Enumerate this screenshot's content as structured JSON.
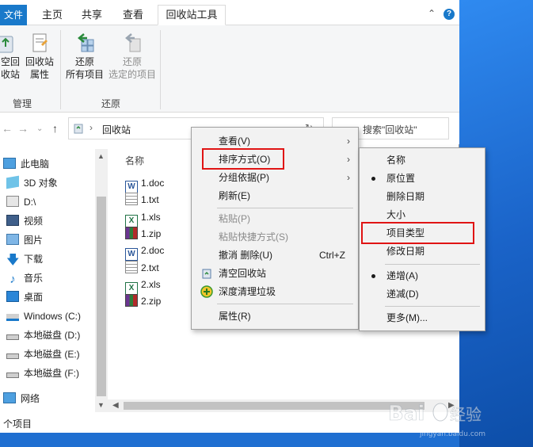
{
  "tabs": {
    "file": "文件",
    "home": "主页",
    "share": "共享",
    "view": "查看",
    "tools": "回收站工具"
  },
  "ribbon": {
    "empty_bin": [
      "空回",
      "收站"
    ],
    "bin_props": [
      "回收站",
      "属性"
    ],
    "restore_all": [
      "还原",
      "所有项目"
    ],
    "restore_selected": [
      "还原",
      "选定的项目"
    ],
    "group_manage": "管理",
    "group_restore": "还原"
  },
  "address": {
    "path": "回收站",
    "search_placeholder": "搜索\"回收站\""
  },
  "navpane": {
    "items": [
      "此电脑",
      "3D 对象",
      "D:\\",
      "视频",
      "图片",
      "下载",
      "音乐",
      "桌面",
      "Windows (C:)",
      "本地磁盘 (D:)",
      "本地磁盘 (E:)",
      "本地磁盘 (F:)",
      "网络"
    ]
  },
  "content": {
    "column_name": "名称",
    "files": [
      {
        "name": "1.doc",
        "type": "doc"
      },
      {
        "name": "1.txt",
        "type": "txt"
      },
      {
        "name": "1.xls",
        "type": "xls"
      },
      {
        "name": "1.zip",
        "type": "zip"
      },
      {
        "name": "2.doc",
        "type": "doc"
      },
      {
        "name": "2.txt",
        "type": "txt"
      },
      {
        "name": "2.xls",
        "type": "xls"
      },
      {
        "name": "2.zip",
        "type": "zip"
      }
    ]
  },
  "status": {
    "items": "个项目"
  },
  "context_menu": {
    "view": "查看(V)",
    "sort": "排序方式(O)",
    "group": "分组依据(P)",
    "refresh": "刷新(E)",
    "paste": "粘贴(P)",
    "paste_shortcut": "粘贴快捷方式(S)",
    "undo": "撤消 删除(U)",
    "undo_shortcut": "Ctrl+Z",
    "empty_bin": "清空回收站",
    "deep_clean": "深度清理垃圾",
    "properties": "属性(R)"
  },
  "sort_menu": {
    "name": "名称",
    "original_location": "原位置",
    "date_deleted": "删除日期",
    "size": "大小",
    "item_type": "项目类型",
    "date_modified": "修改日期",
    "ascending": "递增(A)",
    "descending": "递减(D)",
    "more": "更多(M)..."
  },
  "colors": {
    "accent": "#1979ca",
    "highlight_box": "#e01414",
    "menu_bg": "#f2f2f2"
  }
}
